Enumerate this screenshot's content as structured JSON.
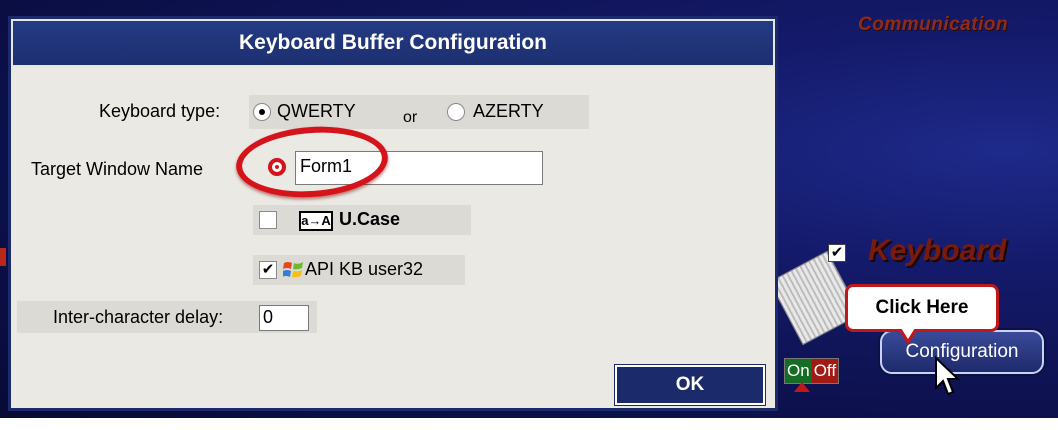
{
  "dialog": {
    "title": "Keyboard Buffer Configuration",
    "keyboard_type_label": "Keyboard type:",
    "keyboard_options": [
      "QWERTY",
      "AZERTY"
    ],
    "or_text": "or",
    "selected_keyboard": "QWERTY",
    "target_window_label": "Target Window Name",
    "target_window_value": "Form1",
    "ucase_icon_text": "a→A",
    "ucase_label": "U.Case",
    "ucase_checked": false,
    "api_label": "API KB user32",
    "api_checked": true,
    "delay_label": "Inter-character delay:",
    "delay_value": "0",
    "ok_label": "OK"
  },
  "background": {
    "title": "Communication",
    "keyboard_label": "Keyboard",
    "keyboard_checked": true,
    "config_button": "Configuration",
    "on_label": "On",
    "off_label": "Off",
    "tooltip": "Click Here"
  },
  "colors": {
    "titlebar": "#1c2f70",
    "dialog_bg": "#ebe9e3",
    "highlight_red": "#d4141a",
    "bg_blue": "#141a6a"
  },
  "icons": [
    "radio-icon",
    "checkbox-icon",
    "windows-logo-icon",
    "cursor-arrow-icon"
  ]
}
